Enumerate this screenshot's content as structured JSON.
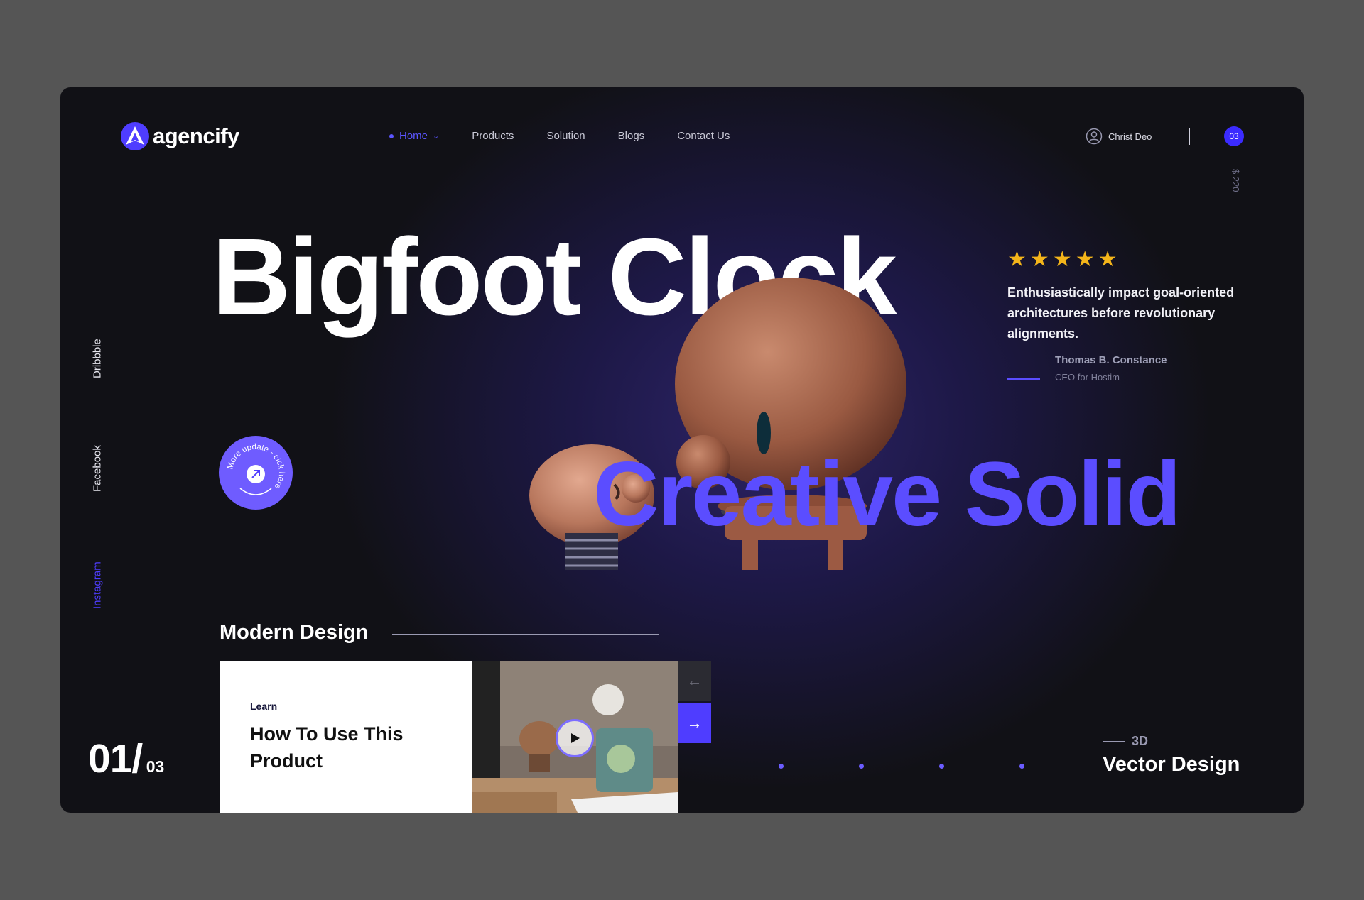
{
  "brand": {
    "name": "agencify"
  },
  "nav": {
    "items": [
      {
        "label": "Home",
        "active": true
      },
      {
        "label": "Products"
      },
      {
        "label": "Solution"
      },
      {
        "label": "Blogs"
      },
      {
        "label": "Contact Us"
      }
    ]
  },
  "user": {
    "name": "Christ Deo"
  },
  "cart": {
    "count": "03",
    "price": "$ 220"
  },
  "socials": [
    "Dribbble",
    "Facebook",
    "Instagram"
  ],
  "hero": {
    "title": "Bigfoot Clock",
    "accent": "Creative Solid"
  },
  "review": {
    "rating": 5,
    "quote": "Enthusiastically impact goal-oriented architectures before revolutionary alignments.",
    "author": "Thomas B. Constance",
    "role": "CEO for Hostim"
  },
  "cta": {
    "text": "More update - cick here"
  },
  "section": {
    "title": "Modern Design",
    "card": {
      "kicker": "Learn",
      "title": "How To Use This Product"
    }
  },
  "slider": {
    "current": "01",
    "separator": "/",
    "total": "03",
    "dots": 4
  },
  "feature": {
    "small": "3D",
    "big": "Vector Design"
  },
  "colors": {
    "accent": "#5b4dff",
    "star": "#f4b51a",
    "background": "#111116"
  }
}
